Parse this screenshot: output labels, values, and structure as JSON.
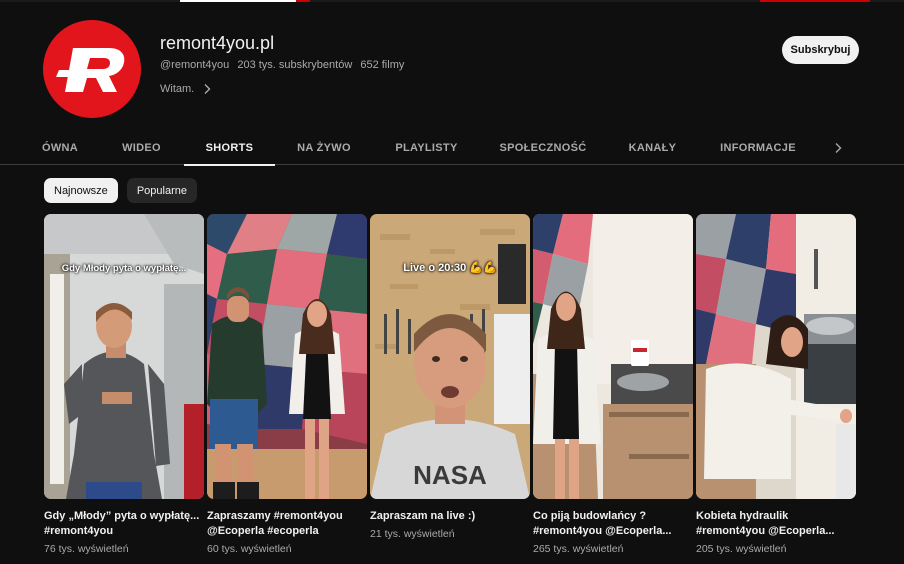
{
  "channel": {
    "name": "remont4you.pl",
    "handle": "@remont4you",
    "subscribers": "203 tys. subskrybentów",
    "videos": "652 filmy",
    "welcome": "Witam.",
    "subscribe_label": "Subskrybuj",
    "avatar_color": "#e3151c"
  },
  "tabs": [
    {
      "label": "ÓWNA",
      "active": false
    },
    {
      "label": "WIDEO",
      "active": false
    },
    {
      "label": "SHORTS",
      "active": true
    },
    {
      "label": "NA ŻYWO",
      "active": false
    },
    {
      "label": "PLAYLISTY",
      "active": false
    },
    {
      "label": "SPOŁECZNOŚĆ",
      "active": false
    },
    {
      "label": "KANAŁY",
      "active": false
    },
    {
      "label": "INFORMACJE",
      "active": false
    }
  ],
  "tabs_next_icon": "chevron-right-icon",
  "filters": [
    {
      "label": "Najnowsze",
      "selected": true
    },
    {
      "label": "Popularne",
      "selected": false
    }
  ],
  "shorts": [
    {
      "title": "Gdy „Młody” pyta o wypłatę... #remont4you",
      "views": "76 tys. wyświetleń",
      "overlay": "Gdy Młody pyta o wypłatę..."
    },
    {
      "title": "Zapraszamy #remont4you @Ecoperla #ecoperla",
      "views": "60 tys. wyświetleń",
      "overlay": ""
    },
    {
      "title": "Zapraszam na live :)",
      "views": "21 tys. wyświetleń",
      "overlay": "Live o 20:30 💪💪"
    },
    {
      "title": "Co piją budowlańcy ? #remont4you @Ecoperla...",
      "views": "265 tys. wyświetleń",
      "overlay": ""
    },
    {
      "title": "Kobieta hydraulik #remont4you @Ecoperla...",
      "views": "205 tys. wyświetleń",
      "overlay": ""
    }
  ]
}
